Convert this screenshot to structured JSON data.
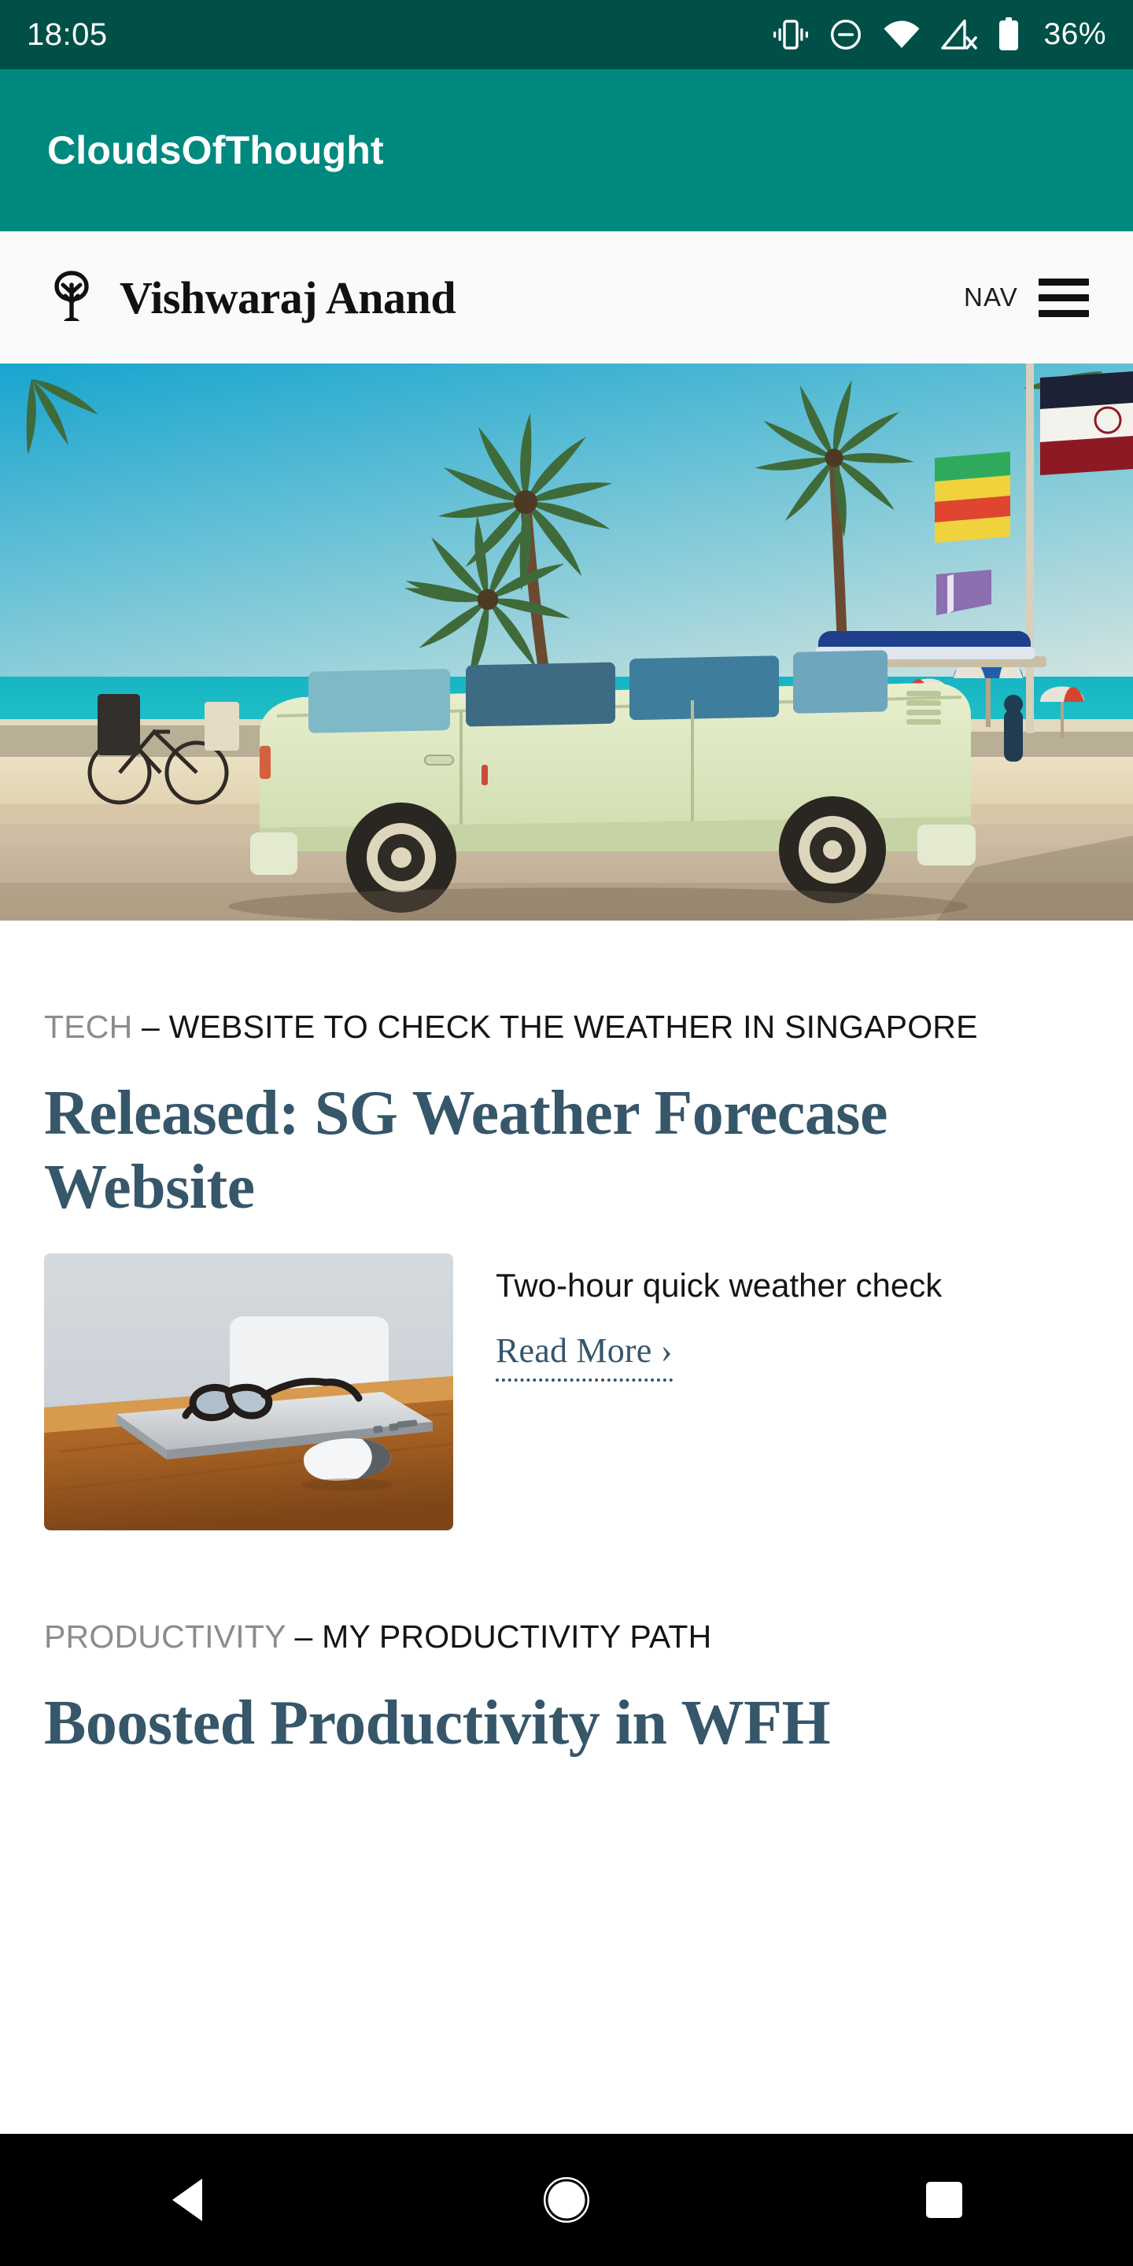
{
  "statusbar": {
    "time": "18:05",
    "battery_percent": "36%",
    "icons": [
      "vibrate-icon",
      "do-not-disturb-icon",
      "wifi-icon",
      "cellular-off-icon",
      "battery-icon"
    ],
    "background_color": "#005047"
  },
  "appbar": {
    "title": "CloudsOfThought",
    "background_color": "#00897e"
  },
  "site_header": {
    "logo_icon": "tree-icon",
    "brand_name": "Vishwaraj Anand",
    "nav_label": "NAV",
    "menu_icon": "hamburger-icon"
  },
  "hero": {
    "alt": "vintage camper van parked at a tropical beach with palm trees"
  },
  "posts": [
    {
      "category": "TECH",
      "separator": " – ",
      "subtitle": "WEBSITE TO CHECK THE WEATHER IN SINGAPORE",
      "title": "Released: SG Weather Forecase Website",
      "excerpt": "Two-hour quick weather check",
      "read_more": "Read More ›",
      "thumbnail_alt": "laptop with eyeglasses and mouse on a wooden desk",
      "accent_color": "#36566a"
    },
    {
      "category": "PRODUCTIVITY",
      "separator": " – ",
      "subtitle": "MY PRODUCTIVITY PATH",
      "title": "Boosted Productivity in WFH",
      "accent_color": "#36566a"
    }
  ],
  "navbar": {
    "back": "back-icon",
    "home": "home-icon",
    "recents": "recents-icon"
  }
}
